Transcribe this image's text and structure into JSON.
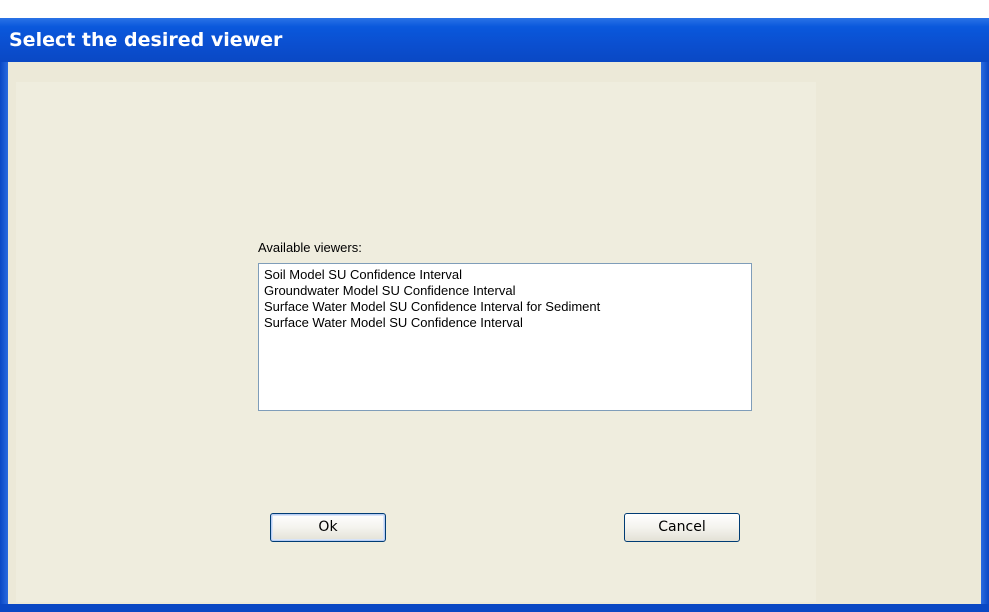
{
  "window": {
    "title": "Select the desired viewer"
  },
  "viewers": {
    "label": "Available viewers:",
    "items": [
      "Soil Model SU Confidence Interval",
      "Groundwater Model SU Confidence Interval",
      "Surface Water Model SU Confidence Interval for Sediment",
      "Surface Water Model SU Confidence Interval"
    ]
  },
  "buttons": {
    "ok_label": "Ok",
    "cancel_label": "Cancel"
  },
  "colors": {
    "titlebar": "#0a58dc",
    "dialog_background": "#ece9d8",
    "button_border": "#003c74"
  }
}
